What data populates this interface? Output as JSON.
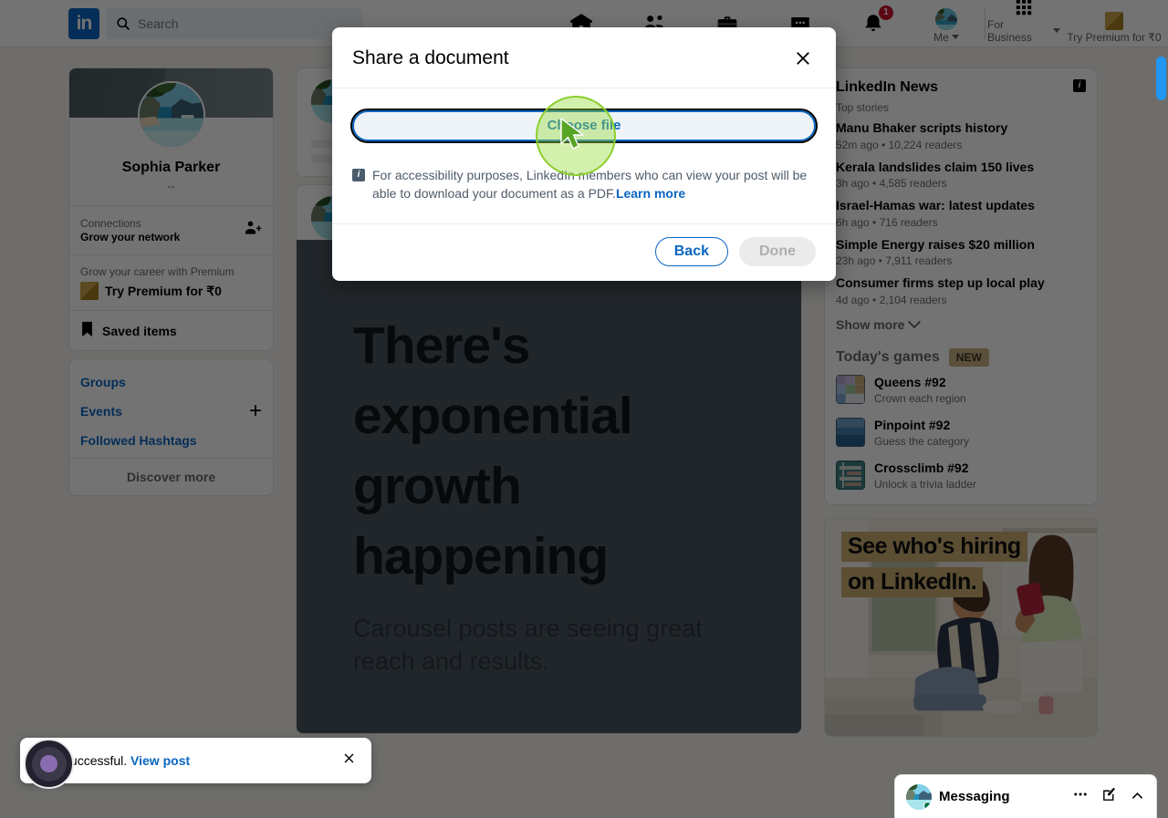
{
  "nav": {
    "logo": "in",
    "search_placeholder": "Search",
    "search_value": "",
    "items": [
      {
        "name": "home",
        "label": ""
      },
      {
        "name": "network",
        "label": ""
      },
      {
        "name": "jobs",
        "label": ""
      },
      {
        "name": "messaging",
        "label": ""
      },
      {
        "name": "notifications",
        "label": "",
        "badge": "1"
      }
    ],
    "me_label": "Me",
    "business_label": "For Business",
    "premium_label": "Try Premium for ₹0"
  },
  "sidebar": {
    "profile_name": "Sophia Parker",
    "profile_subtitle": "--",
    "connections_label": "Connections",
    "connections_cta": "Grow your network",
    "premium_caption": "Grow your career with Premium",
    "premium_cta": "Try Premium for ₹0",
    "saved_items": "Saved items",
    "links": [
      {
        "label": "Groups",
        "has_plus": false
      },
      {
        "label": "Events",
        "has_plus": true
      },
      {
        "label": "Followed Hashtags",
        "has_plus": false
      }
    ],
    "discover_more": "Discover more"
  },
  "feed": {
    "carousel_title": "There's exponential growth happening",
    "carousel_subtitle": "Carousel posts are seeing great reach and results."
  },
  "news": {
    "title": "LinkedIn News",
    "subtitle": "Top stories",
    "info_icon": "i",
    "stories": [
      {
        "headline": "Manu Bhaker scripts history",
        "meta": "52m ago • 10,224 readers"
      },
      {
        "headline": "Kerala landslides claim 150 lives",
        "meta": "3h ago • 4,585 readers"
      },
      {
        "headline": "Israel-Hamas war: latest updates",
        "meta": "6h ago • 716 readers"
      },
      {
        "headline": "Simple Energy raises $20 million",
        "meta": "23h ago • 7,911 readers"
      },
      {
        "headline": "Consumer firms step up local play",
        "meta": "4d ago • 2,104 readers"
      }
    ],
    "show_more": "Show more",
    "games_title": "Today's games",
    "games_badge": "NEW",
    "games": [
      {
        "name": "Queens #92",
        "desc": "Crown each region",
        "tile": "queens"
      },
      {
        "name": "Pinpoint #92",
        "desc": "Guess the category",
        "tile": "pinpoint"
      },
      {
        "name": "Crossclimb #92",
        "desc": "Unlock a trivia ladder",
        "tile": "crossclimb"
      }
    ]
  },
  "ad": {
    "line1": "See who's hiring",
    "line2": "on LinkedIn."
  },
  "messaging": {
    "label": "Messaging"
  },
  "toast": {
    "text": "Post successful. ",
    "link": "View post"
  },
  "modal": {
    "title": "Share a document",
    "choose_file_label": "Choose file",
    "accessibility_icon": "i",
    "accessibility_text": "For accessibility purposes, LinkedIn members who can view your post will be able to download your document as a PDF.",
    "learn_more": "Learn more",
    "back_label": "Back",
    "done_label": "Done"
  },
  "colors": {
    "brand_blue": "#0a66c2",
    "badge_red": "#cb112d",
    "scrollbar": "#2196f3",
    "cursor_halo": "#8ccf2f",
    "premium_gold": "#c8a24a"
  }
}
